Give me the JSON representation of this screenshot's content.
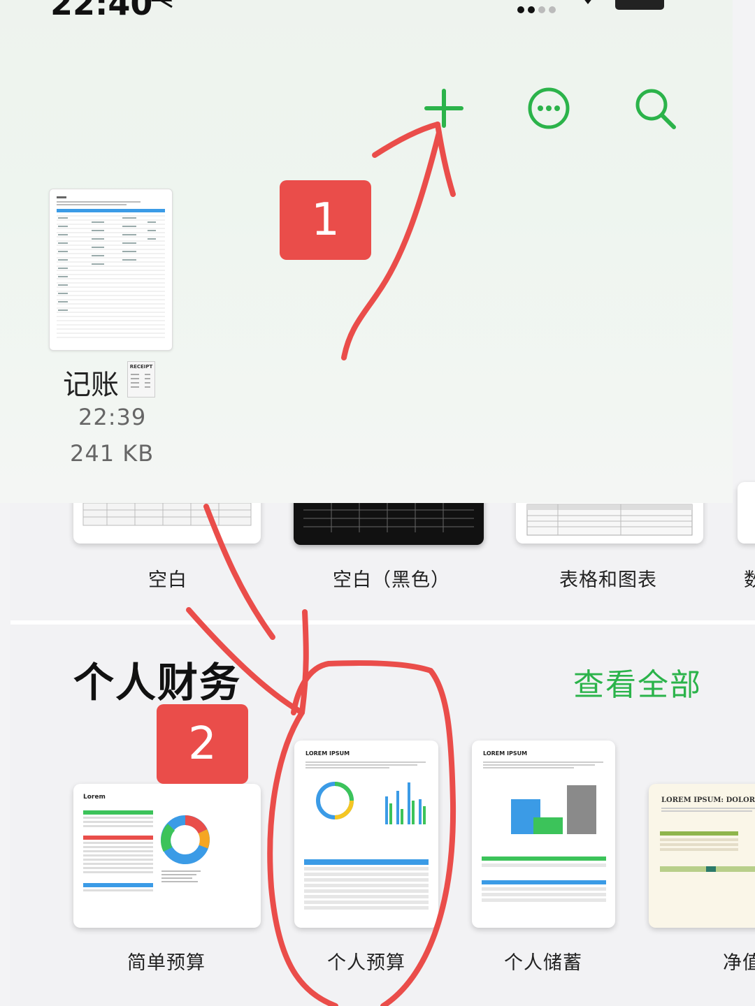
{
  "status_bar": {
    "time": "22:40"
  },
  "toolbar": {
    "add_icon": "plus-icon",
    "more_icon": "ellipsis-circle-icon",
    "search_icon": "magnifier-icon",
    "accent": "#2bb34a"
  },
  "recent_file": {
    "name": "记账",
    "time": "22:39",
    "size": "241 KB",
    "receipt_badge": "RECEIPT"
  },
  "basic_templates": [
    {
      "label": "空白"
    },
    {
      "label": "空白（黑色）"
    },
    {
      "label": "表格和图表"
    },
    {
      "label": "数"
    }
  ],
  "personal_finance": {
    "title": "个人财务",
    "view_all": "查看全部",
    "templates": [
      {
        "label": "简单预算",
        "thumb_title": "Lorem"
      },
      {
        "label": "个人预算",
        "thumb_title": "LOREM IPSUM"
      },
      {
        "label": "个人储蓄",
        "thumb_title": "LOREM IPSUM"
      },
      {
        "label": "净值",
        "thumb_title": "LOREM IPSUM: DOLOR"
      }
    ]
  },
  "annotations": {
    "step1": "1",
    "step2": "2",
    "color": "#ea4d4a"
  }
}
